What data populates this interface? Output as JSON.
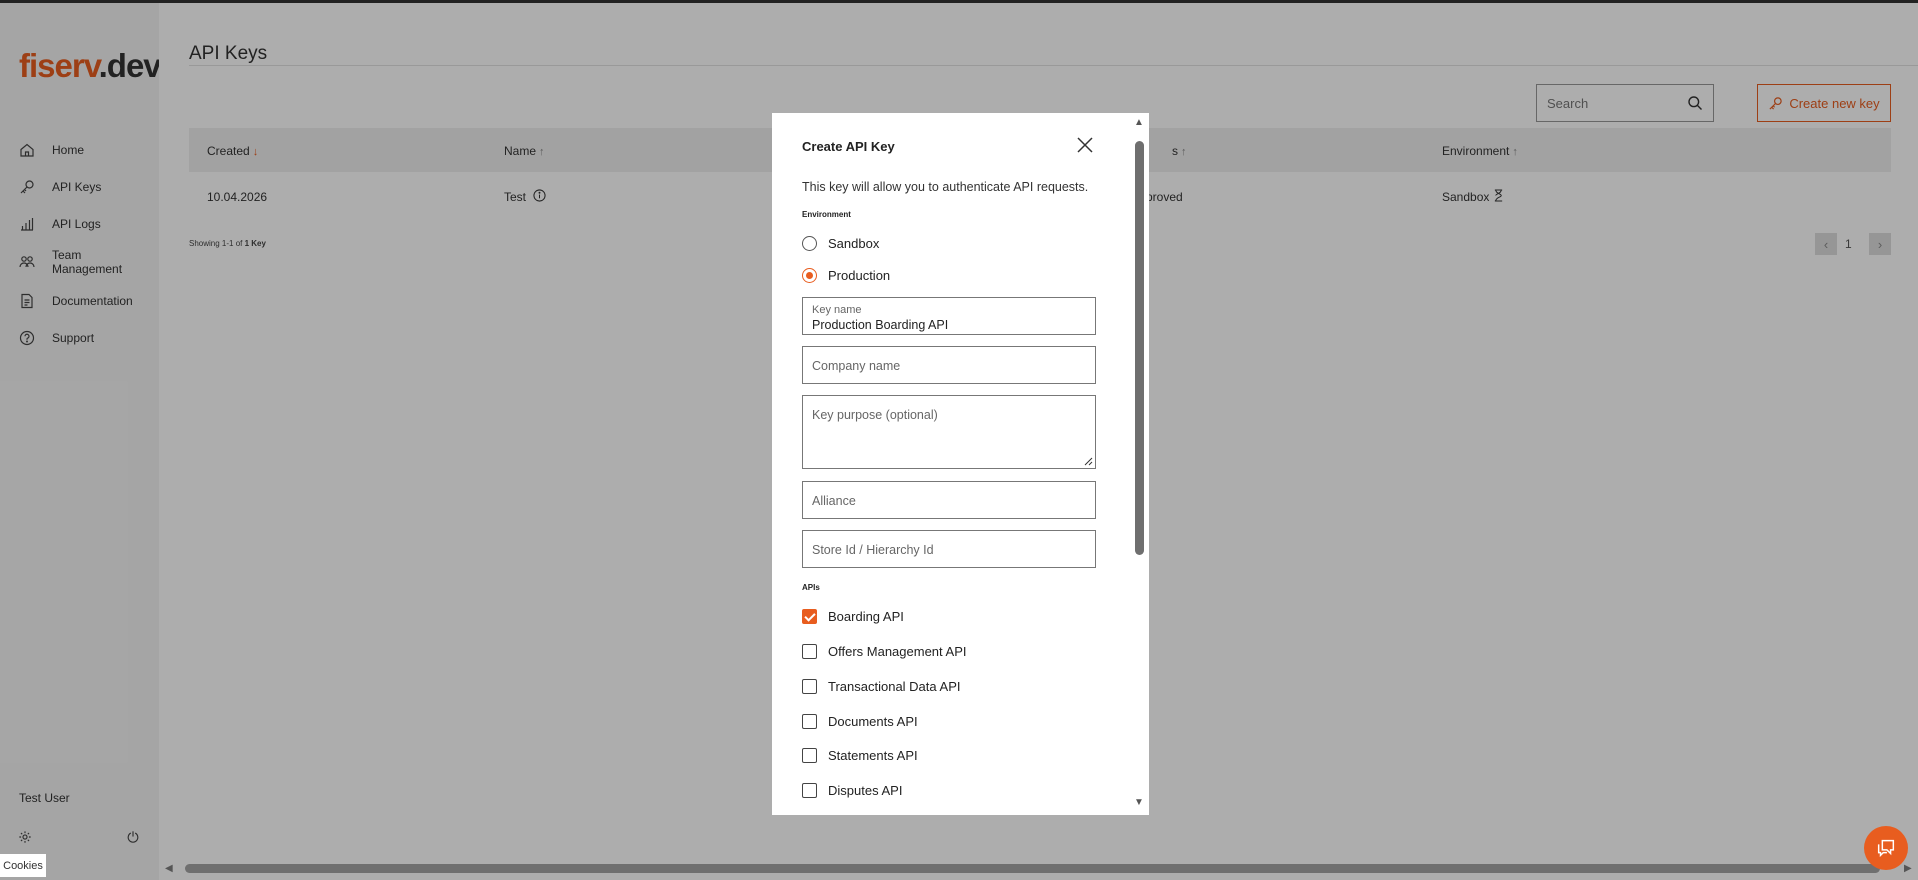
{
  "brand": {
    "part1": "fiserv",
    "part2": ".dev"
  },
  "sidebar": {
    "items": [
      {
        "label": "Home",
        "icon": "home-icon"
      },
      {
        "label": "API Keys",
        "icon": "key-icon"
      },
      {
        "label": "API Logs",
        "icon": "bar-chart-icon"
      },
      {
        "label": "Team\nManagement",
        "icon": "team-icon"
      },
      {
        "label": "Documentation",
        "icon": "document-icon"
      },
      {
        "label": "Support",
        "icon": "help-circle-icon"
      }
    ],
    "user": "Test User",
    "cookies": "Cookies"
  },
  "page": {
    "title": "API Keys",
    "search_placeholder": "Search",
    "create_button": "Create new key"
  },
  "table": {
    "columns": [
      "Created",
      "Name",
      "s",
      "Environment"
    ],
    "sort_arrow_active": "↓",
    "sort_arrow": "↑",
    "rows": [
      {
        "created": "10.04.2026",
        "name": "Test",
        "status": "proved",
        "environment": "Sandbox"
      }
    ],
    "showing_prefix": "Showing 1-1 of ",
    "showing_count": "1 Key",
    "page": "1"
  },
  "modal": {
    "title": "Create API Key",
    "description": "This key will allow you to authenticate API requests.",
    "environment_label": "Environment",
    "environments": [
      {
        "label": "Sandbox",
        "selected": false
      },
      {
        "label": "Production",
        "selected": true
      }
    ],
    "key_name_label": "Key name",
    "key_name_value": "Production Boarding API",
    "company_placeholder": "Company name",
    "purpose_placeholder": "Key purpose (optional)",
    "alliance_placeholder": "Alliance",
    "store_placeholder": "Store Id / Hierarchy Id",
    "apis_label": "APIs",
    "apis": [
      {
        "label": "Boarding API",
        "checked": true
      },
      {
        "label": "Offers Management API",
        "checked": false
      },
      {
        "label": "Transactional Data API",
        "checked": false
      },
      {
        "label": "Documents API",
        "checked": false
      },
      {
        "label": "Statements API",
        "checked": false
      },
      {
        "label": "Disputes API",
        "checked": false
      }
    ]
  },
  "colors": {
    "accent": "#e85d1f",
    "overlay": "rgba(0,0,0,0.32)",
    "sidebar_bg": "#f4f4f4"
  }
}
